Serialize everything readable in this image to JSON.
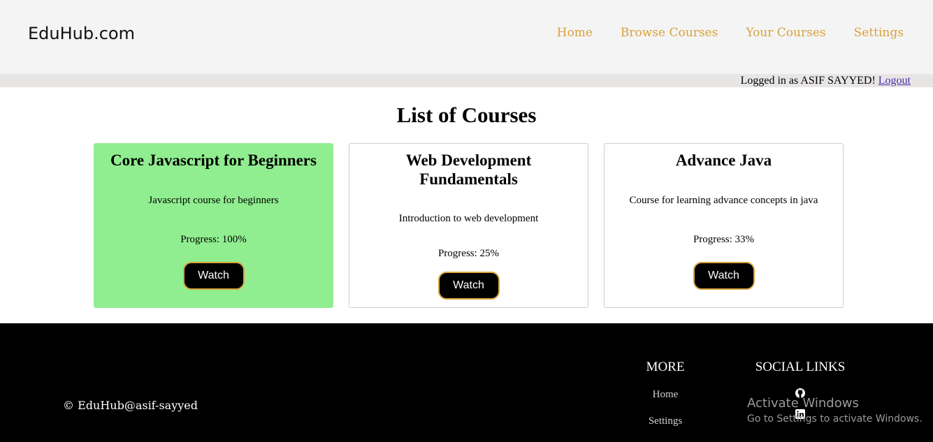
{
  "header": {
    "logo": "EduHub.com",
    "nav": [
      "Home",
      "Browse Courses",
      "Your Courses",
      "Settings"
    ]
  },
  "userbar": {
    "text": "Logged in as ASIF SAYYED!",
    "logout": "Logout"
  },
  "main": {
    "title": "List of Courses",
    "courses": [
      {
        "title": "Core Javascript for Beginners",
        "description": "Javascript course for beginners",
        "progress": "Progress: 100%",
        "progress_value": 100,
        "button": "Watch"
      },
      {
        "title": "Web Development Fundamentals",
        "description": "Introduction to web development",
        "progress": "Progress: 25%",
        "progress_value": 25,
        "button": "Watch"
      },
      {
        "title": "Advance Java",
        "description": "Course for learning advance concepts in java",
        "progress": "Progress: 33%",
        "progress_value": 33,
        "button": "Watch"
      }
    ],
    "completed_color": "#90ee90",
    "accent_color": "#d8a23c"
  },
  "footer": {
    "copyright": "© EduHub@asif-sayyed",
    "more_heading": "MORE",
    "more_links": [
      "Home",
      "Settings"
    ],
    "social_heading": "SOCIAL LINKS",
    "social_icons": [
      "github-icon",
      "linkedin-icon"
    ]
  },
  "watermark": {
    "line1": "Activate Windows",
    "line2": "Go to Settings to activate Windows."
  }
}
